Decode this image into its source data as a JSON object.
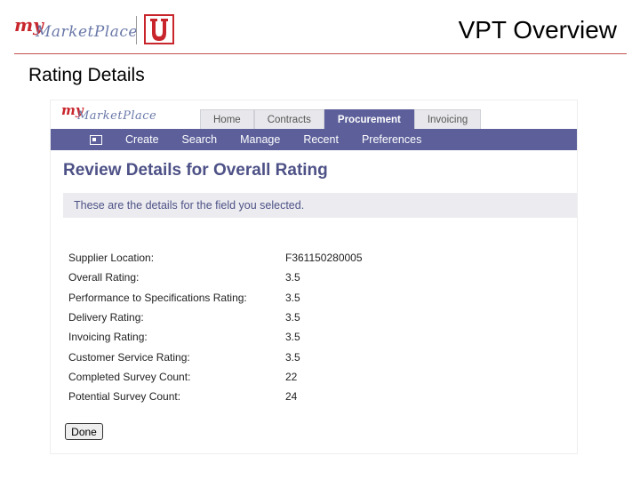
{
  "slide": {
    "title": "VPT Overview",
    "subtitle": "Rating Details"
  },
  "brand": {
    "logo_text_my": "my",
    "logo_text_marketplace": "MarketPlace",
    "colors": {
      "red": "#c8262c",
      "purple": "#5c5f9a",
      "heading": "#4d5186",
      "rule": "#c0504d"
    }
  },
  "app": {
    "tabs": [
      {
        "label": "Home",
        "active": false
      },
      {
        "label": "Contracts",
        "active": false
      },
      {
        "label": "Procurement",
        "active": true
      },
      {
        "label": "Invoicing",
        "active": false
      }
    ],
    "menu": {
      "icon": "layout-icon",
      "items": [
        "Create",
        "Search",
        "Manage",
        "Recent",
        "Preferences"
      ]
    },
    "heading": "Review Details for Overall Rating",
    "info": "These are the details for the field you selected.",
    "details": [
      {
        "label": "Supplier Location:",
        "value": "F361150280005"
      },
      {
        "label": "Overall Rating:",
        "value": "3.5"
      },
      {
        "label": "Performance to Specifications Rating:",
        "value": "3.5"
      },
      {
        "label": "Delivery Rating:",
        "value": "3.5"
      },
      {
        "label": "Invoicing Rating:",
        "value": "3.5"
      },
      {
        "label": "Customer Service Rating:",
        "value": "3.5"
      },
      {
        "label": "Completed Survey Count:",
        "value": "22"
      },
      {
        "label": "Potential Survey Count:",
        "value": "24"
      }
    ],
    "done_label": "Done"
  }
}
